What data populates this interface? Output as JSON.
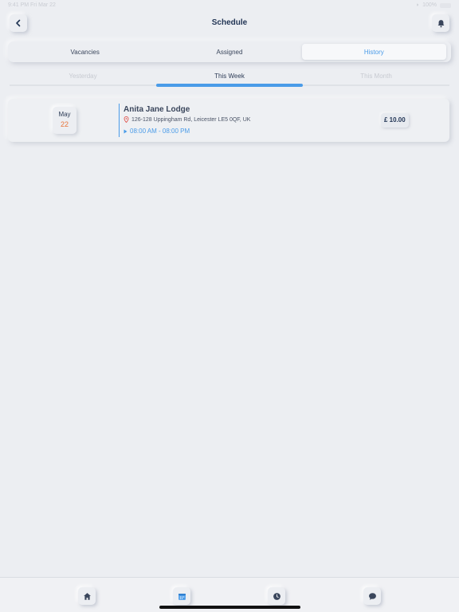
{
  "status_bar": {
    "time": "9:41 PM",
    "date": "Fri Mar 22",
    "battery": "100%"
  },
  "header": {
    "title": "Schedule",
    "back_icon": "chevron-left-icon",
    "notify_icon": "bell-icon"
  },
  "segments": [
    {
      "label": "Vacancies",
      "active": false
    },
    {
      "label": "Assigned",
      "active": false
    },
    {
      "label": "History",
      "active": true
    }
  ],
  "subtabs": [
    {
      "label": "Yesterday",
      "active": false
    },
    {
      "label": "This Week",
      "active": true
    },
    {
      "label": "This Month",
      "active": false
    }
  ],
  "shift": {
    "month": "May",
    "day": "22",
    "name": "Anita Jane Lodge",
    "address": "126-128 Uppingham Rd, Leicester LE5 0QF, UK",
    "time": "08:00 AM - 08:00 PM",
    "price": "£ 10.00"
  },
  "bottom_nav": [
    {
      "name": "home",
      "icon": "home-icon"
    },
    {
      "name": "calendar",
      "icon": "calendar-icon",
      "active": true
    },
    {
      "name": "clock",
      "icon": "clock-icon"
    },
    {
      "name": "chat",
      "icon": "chat-icon"
    }
  ],
  "colors": {
    "accent": "#4a9be8",
    "date_day": "#e8743a",
    "pin": "#e0524a",
    "background": "#eceef2"
  }
}
